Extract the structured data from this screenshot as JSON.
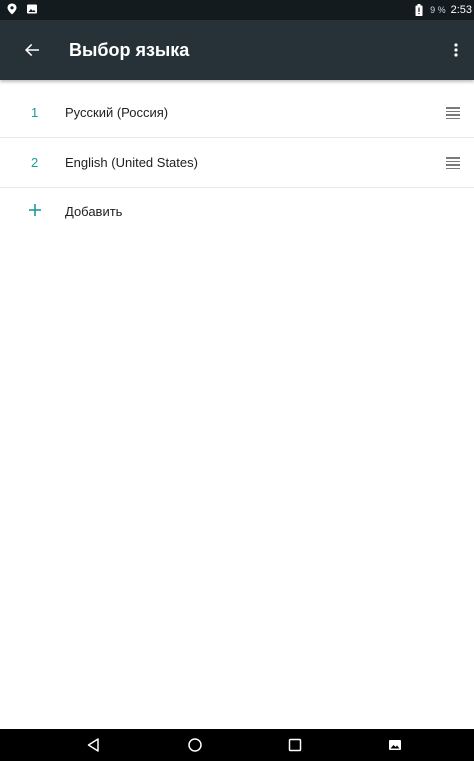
{
  "status_bar": {
    "battery_percent": "9 %",
    "time": "2:53",
    "left_icons": [
      "location-pin-icon",
      "image-notification-icon"
    ],
    "right_icons": [
      "battery-icon"
    ]
  },
  "app_bar": {
    "title": "Выбор языка",
    "back_icon": "arrow-back-icon",
    "overflow_icon": "more-vert-icon"
  },
  "languages": [
    {
      "index": "1",
      "label": "Русский (Россия)"
    },
    {
      "index": "2",
      "label": "English (United States)"
    }
  ],
  "add_action": {
    "label": "Добавить",
    "icon": "plus-icon"
  },
  "nav_bar": {
    "icons": [
      "back-triangle-icon",
      "home-circle-icon",
      "recents-square-icon",
      "screenshot-icon"
    ]
  },
  "colors": {
    "status_bar": "#131b1f",
    "app_bar": "#263238",
    "accent": "#1f9a96",
    "text_primary": "#212121",
    "divider": "#e8e8e8"
  }
}
